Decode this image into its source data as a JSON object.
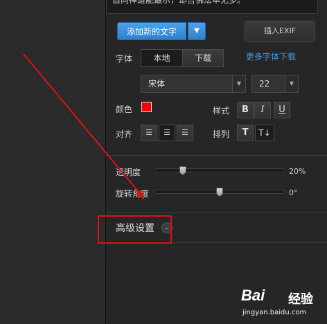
{
  "preview": {
    "text": "自同禅道能最示，却吾佛法本无多。"
  },
  "toolbar": {
    "add_text_label": "添加新的文字",
    "insert_exif_label": "插入EXIF"
  },
  "font": {
    "label": "字体",
    "tab_local": "本地",
    "tab_download": "下载",
    "more_fonts_link": "更多字体下载",
    "family_value": "宋体",
    "size_value": "22"
  },
  "color": {
    "label": "颜色",
    "value": "#ff0000"
  },
  "style": {
    "label": "样式",
    "bold": "B",
    "italic": "I",
    "underline": "U"
  },
  "align": {
    "label": "对齐"
  },
  "arrange": {
    "label": "排列",
    "horizontal": "T",
    "vertical": "T↓"
  },
  "opacity": {
    "label": "透明度",
    "value_text": "20%",
    "value": 0.2
  },
  "rotation": {
    "label": "旋转角度",
    "value_text": "0°",
    "value": 0.5
  },
  "advanced": {
    "label": "高级设置"
  },
  "watermark": {
    "brand": "Bai",
    "brand2": "经验",
    "url": "jingyan.baidu.com"
  },
  "colors": {
    "accent": "#2d7fcc",
    "link": "#3d9be9",
    "annotation": "#e01010",
    "panel_bg": "#262626"
  }
}
